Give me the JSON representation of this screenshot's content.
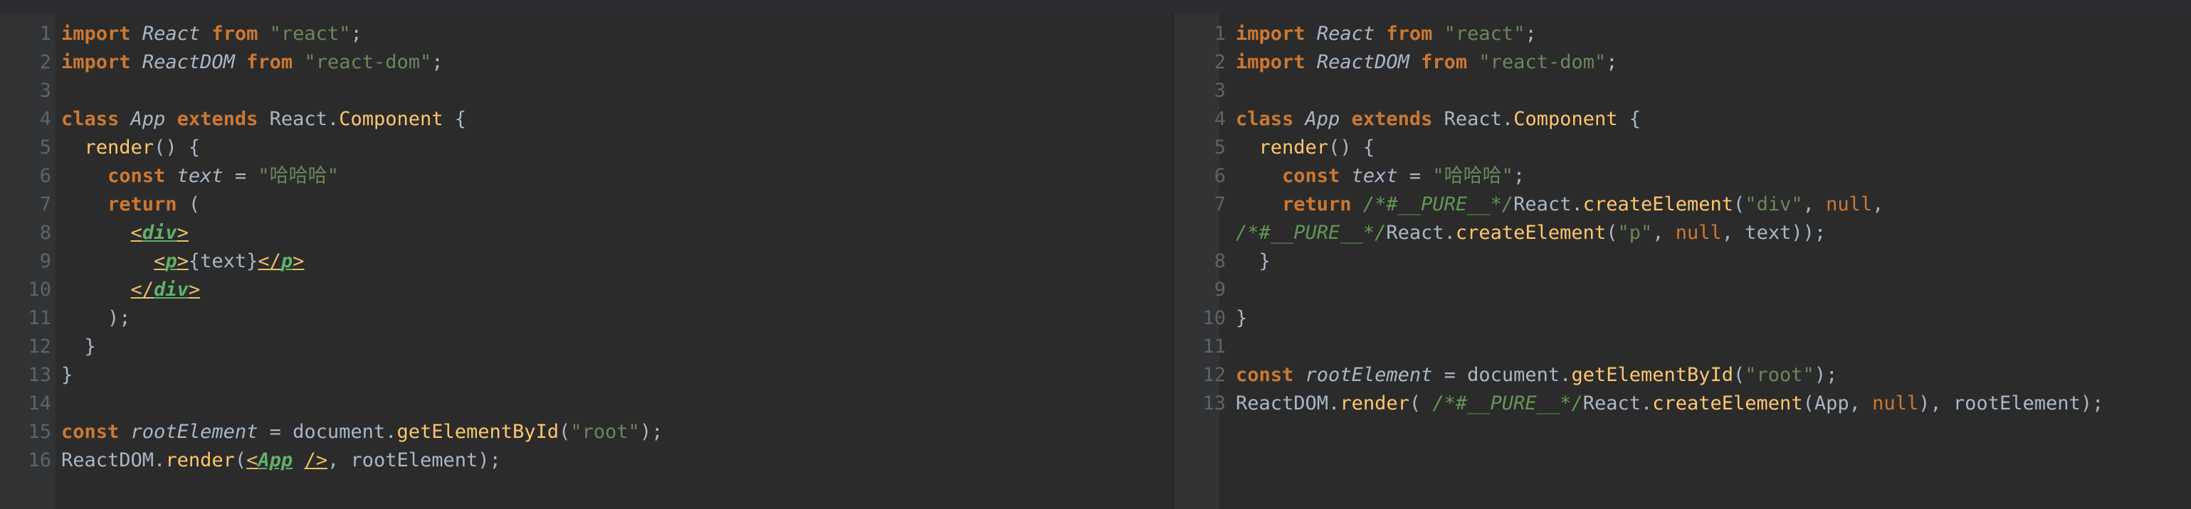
{
  "colors": {
    "background": "#2b2b2b",
    "gutter": "#313335",
    "keyword": "#cc7832",
    "string": "#6a8759",
    "function": "#ffc66d",
    "identifier": "#a9b7c6",
    "comment": "#629755",
    "line_number": "#606366"
  },
  "left": {
    "lines": [
      {
        "n": "1",
        "tokens": [
          {
            "t": "import",
            "c": "kw"
          },
          {
            "t": " "
          },
          {
            "t": "React",
            "c": "cls"
          },
          {
            "t": " "
          },
          {
            "t": "from",
            "c": "kw"
          },
          {
            "t": " "
          },
          {
            "t": "\"react\"",
            "c": "str"
          },
          {
            "t": ";"
          }
        ]
      },
      {
        "n": "2",
        "tokens": [
          {
            "t": "import",
            "c": "kw"
          },
          {
            "t": " "
          },
          {
            "t": "ReactDOM",
            "c": "cls"
          },
          {
            "t": " "
          },
          {
            "t": "from",
            "c": "kw"
          },
          {
            "t": " "
          },
          {
            "t": "\"react-dom\"",
            "c": "str"
          },
          {
            "t": ";"
          }
        ]
      },
      {
        "n": "3",
        "tokens": []
      },
      {
        "n": "4",
        "tokens": [
          {
            "t": "class",
            "c": "kw"
          },
          {
            "t": " "
          },
          {
            "t": "App",
            "c": "cls"
          },
          {
            "t": " "
          },
          {
            "t": "extends",
            "c": "kw"
          },
          {
            "t": " React."
          },
          {
            "t": "Component",
            "c": "fn"
          },
          {
            "t": " {"
          }
        ]
      },
      {
        "n": "5",
        "tokens": [
          {
            "t": "  "
          },
          {
            "t": "render",
            "c": "fn"
          },
          {
            "t": "() {"
          }
        ]
      },
      {
        "n": "6",
        "tokens": [
          {
            "t": "    "
          },
          {
            "t": "const",
            "c": "kw"
          },
          {
            "t": " "
          },
          {
            "t": "text",
            "c": "cls"
          },
          {
            "t": " = "
          },
          {
            "t": "\"哈哈哈\"",
            "c": "str"
          }
        ]
      },
      {
        "n": "7",
        "tokens": [
          {
            "t": "    "
          },
          {
            "t": "return",
            "c": "kw"
          },
          {
            "t": " ("
          }
        ]
      },
      {
        "n": "8",
        "tokens": [
          {
            "t": "      "
          },
          {
            "t": "<",
            "c": "tag"
          },
          {
            "t": "div",
            "c": "tagname"
          },
          {
            "t": ">",
            "c": "tag"
          }
        ]
      },
      {
        "n": "9",
        "tokens": [
          {
            "t": "        "
          },
          {
            "t": "<",
            "c": "tag"
          },
          {
            "t": "p",
            "c": "tagname"
          },
          {
            "t": ">",
            "c": "tag"
          },
          {
            "t": "{text}"
          },
          {
            "t": "</",
            "c": "tag"
          },
          {
            "t": "p",
            "c": "tagname"
          },
          {
            "t": ">",
            "c": "tag"
          }
        ]
      },
      {
        "n": "10",
        "tokens": [
          {
            "t": "      "
          },
          {
            "t": "</",
            "c": "tag"
          },
          {
            "t": "div",
            "c": "tagname"
          },
          {
            "t": ">",
            "c": "tag"
          }
        ]
      },
      {
        "n": "11",
        "tokens": [
          {
            "t": "    );"
          }
        ]
      },
      {
        "n": "12",
        "tokens": [
          {
            "t": "  }"
          }
        ]
      },
      {
        "n": "13",
        "tokens": [
          {
            "t": "}"
          }
        ]
      },
      {
        "n": "14",
        "tokens": []
      },
      {
        "n": "15",
        "tokens": [
          {
            "t": "const",
            "c": "kw"
          },
          {
            "t": " "
          },
          {
            "t": "rootElement",
            "c": "cls"
          },
          {
            "t": " = document."
          },
          {
            "t": "getElementById",
            "c": "fn"
          },
          {
            "t": "("
          },
          {
            "t": "\"root\"",
            "c": "str"
          },
          {
            "t": ");"
          }
        ]
      },
      {
        "n": "16",
        "tokens": [
          {
            "t": "ReactDOM."
          },
          {
            "t": "render",
            "c": "fn"
          },
          {
            "t": "("
          },
          {
            "t": "<",
            "c": "tag"
          },
          {
            "t": "App",
            "c": "tagname"
          },
          {
            "t": " "
          },
          {
            "t": "/>",
            "c": "tag"
          },
          {
            "t": ", rootElement);"
          }
        ]
      }
    ]
  },
  "right": {
    "lines": [
      {
        "n": "1",
        "tokens": [
          {
            "t": "import",
            "c": "kw"
          },
          {
            "t": " "
          },
          {
            "t": "React",
            "c": "cls"
          },
          {
            "t": " "
          },
          {
            "t": "from",
            "c": "kw"
          },
          {
            "t": " "
          },
          {
            "t": "\"react\"",
            "c": "str"
          },
          {
            "t": ";"
          }
        ]
      },
      {
        "n": "2",
        "tokens": [
          {
            "t": "import",
            "c": "kw"
          },
          {
            "t": " "
          },
          {
            "t": "ReactDOM",
            "c": "cls"
          },
          {
            "t": " "
          },
          {
            "t": "from",
            "c": "kw"
          },
          {
            "t": " "
          },
          {
            "t": "\"react-dom\"",
            "c": "str"
          },
          {
            "t": ";"
          }
        ]
      },
      {
        "n": "3",
        "tokens": []
      },
      {
        "n": "4",
        "tokens": [
          {
            "t": "class",
            "c": "kw"
          },
          {
            "t": " "
          },
          {
            "t": "App",
            "c": "cls"
          },
          {
            "t": " "
          },
          {
            "t": "extends",
            "c": "kw"
          },
          {
            "t": " React."
          },
          {
            "t": "Component",
            "c": "fn"
          },
          {
            "t": " {"
          }
        ]
      },
      {
        "n": "5",
        "tokens": [
          {
            "t": "  "
          },
          {
            "t": "render",
            "c": "fn"
          },
          {
            "t": "() {"
          }
        ]
      },
      {
        "n": "6",
        "tokens": [
          {
            "t": "    "
          },
          {
            "t": "const",
            "c": "kw"
          },
          {
            "t": " "
          },
          {
            "t": "text",
            "c": "cls"
          },
          {
            "t": " = "
          },
          {
            "t": "\"哈哈哈\"",
            "c": "str"
          },
          {
            "t": ";"
          }
        ]
      },
      {
        "n": "7",
        "tokens": [
          {
            "t": "    "
          },
          {
            "t": "return",
            "c": "kw"
          },
          {
            "t": " "
          },
          {
            "t": "/*#__PURE__*/",
            "c": "cmt"
          },
          {
            "t": "React."
          },
          {
            "t": "createElement",
            "c": "fn"
          },
          {
            "t": "("
          },
          {
            "t": "\"div\"",
            "c": "str"
          },
          {
            "t": ", "
          },
          {
            "t": "null",
            "c": "nul"
          },
          {
            "t": ","
          }
        ]
      },
      {
        "n": "",
        "tokens": [
          {
            "t": "/*#__PURE__*/",
            "c": "cmt"
          },
          {
            "t": "React."
          },
          {
            "t": "createElement",
            "c": "fn"
          },
          {
            "t": "("
          },
          {
            "t": "\"p\"",
            "c": "str"
          },
          {
            "t": ", "
          },
          {
            "t": "null",
            "c": "nul"
          },
          {
            "t": ", text));"
          }
        ]
      },
      {
        "n": "8",
        "tokens": [
          {
            "t": "  }"
          }
        ]
      },
      {
        "n": "9",
        "tokens": []
      },
      {
        "n": "10",
        "tokens": [
          {
            "t": "}"
          }
        ]
      },
      {
        "n": "11",
        "tokens": []
      },
      {
        "n": "12",
        "tokens": [
          {
            "t": "const",
            "c": "kw"
          },
          {
            "t": " "
          },
          {
            "t": "rootElement",
            "c": "cls"
          },
          {
            "t": " = document."
          },
          {
            "t": "getElementById",
            "c": "fn"
          },
          {
            "t": "("
          },
          {
            "t": "\"root\"",
            "c": "str"
          },
          {
            "t": ");"
          }
        ]
      },
      {
        "n": "13",
        "tokens": [
          {
            "t": "ReactDOM."
          },
          {
            "t": "render",
            "c": "fn"
          },
          {
            "t": "( "
          },
          {
            "t": "/*#__PURE__*/",
            "c": "cmt"
          },
          {
            "t": "React."
          },
          {
            "t": "createElement",
            "c": "fn"
          },
          {
            "t": "(App, "
          },
          {
            "t": "null",
            "c": "nul"
          },
          {
            "t": "), rootElement);"
          }
        ]
      }
    ]
  }
}
